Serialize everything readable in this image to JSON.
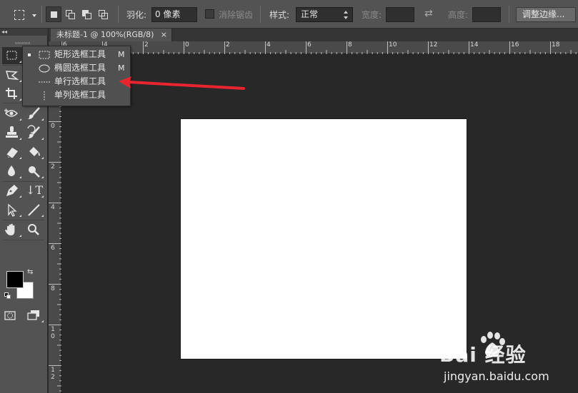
{
  "options_bar": {
    "feather_label": "羽化:",
    "feather_value": "0 像素",
    "antialias_label": "消除锯齿",
    "style_label": "样式:",
    "style_value": "正常",
    "width_label": "宽度:",
    "width_value": "",
    "height_label": "高度:",
    "height_value": "",
    "refine_edge_label": "调整边缘..."
  },
  "document_tab": {
    "title": "未标题-1 @ 100%(RGB/8)",
    "close": "×"
  },
  "ruler_h": [
    "6",
    "4",
    "2",
    "0",
    "2",
    "4",
    "6",
    "8",
    "10",
    "12",
    "14",
    "16",
    "18"
  ],
  "ruler_v": [
    "0",
    "2",
    "4",
    "6",
    "8",
    "1\n0",
    "1\n2"
  ],
  "flyout": {
    "items": [
      {
        "label": "矩形选框工具",
        "shortcut": "M",
        "icon": "rectangular-marquee-icon",
        "current": true
      },
      {
        "label": "椭圆选框工具",
        "shortcut": "M",
        "icon": "elliptical-marquee-icon",
        "current": false
      },
      {
        "label": "单行选框工具",
        "shortcut": "",
        "icon": "single-row-marquee-icon",
        "current": false
      },
      {
        "label": "单列选框工具",
        "shortcut": "",
        "icon": "single-column-marquee-icon",
        "current": false
      }
    ]
  },
  "colors": {
    "foreground": "#000000",
    "background": "#ffffff",
    "annotation_arrow": "#e8252f"
  },
  "watermark": {
    "brand": "Bai 经验",
    "url": "jingyan.baidu.com"
  }
}
